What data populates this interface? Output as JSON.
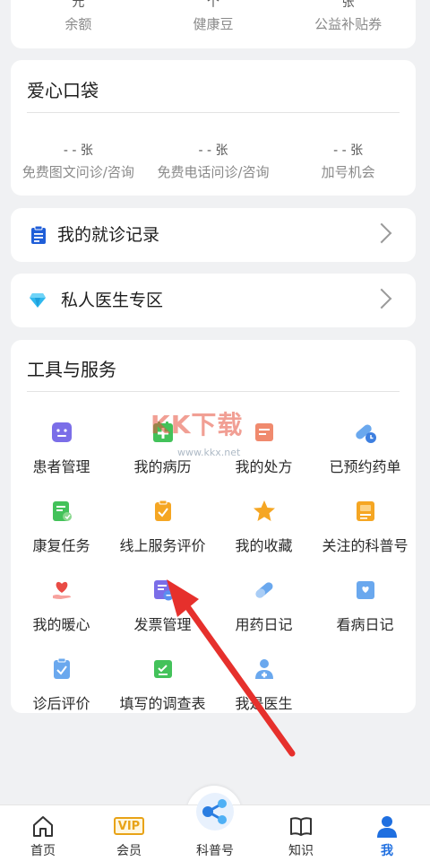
{
  "balance": {
    "items": [
      {
        "value": "元",
        "label": "余额"
      },
      {
        "value": "个",
        "label": "健康豆"
      },
      {
        "value": "张",
        "label": "公益补贴券"
      }
    ]
  },
  "love_pocket": {
    "title": "爱心口袋",
    "items": [
      {
        "value": "- -  张",
        "label": "免费图文问诊/咨询"
      },
      {
        "value": "- -  张",
        "label": "免费电话问诊/咨询"
      },
      {
        "value": "- -  张",
        "label": "加号机会"
      }
    ]
  },
  "visit_records": {
    "label": "我的就诊记录",
    "icon": "clipboard-icon"
  },
  "private_doctor": {
    "label": "私人医生专区",
    "icon": "diamond-icon"
  },
  "tools": {
    "title": "工具与服务",
    "items": [
      {
        "label": "患者管理",
        "icon": "patient-management-icon"
      },
      {
        "label": "我的病历",
        "icon": "medical-record-icon"
      },
      {
        "label": "我的处方",
        "icon": "prescription-icon"
      },
      {
        "label": "已预约药单",
        "icon": "pill-clock-icon"
      },
      {
        "label": "康复任务",
        "icon": "rehab-task-icon"
      },
      {
        "label": "线上服务评价",
        "icon": "service-review-icon"
      },
      {
        "label": "我的收藏",
        "icon": "star-icon"
      },
      {
        "label": "关注的科普号",
        "icon": "science-account-icon"
      },
      {
        "label": "我的暖心",
        "icon": "heart-hand-icon"
      },
      {
        "label": "发票管理",
        "icon": "invoice-icon"
      },
      {
        "label": "用药日记",
        "icon": "pill-icon"
      },
      {
        "label": "看病日记",
        "icon": "diary-icon"
      },
      {
        "label": "诊后评价",
        "icon": "review-clipboard-icon"
      },
      {
        "label": "填写的调查表",
        "icon": "survey-icon"
      },
      {
        "label": "我是医生",
        "icon": "doctor-icon"
      }
    ]
  },
  "watermark": {
    "text": "KK下载",
    "sub": "www.kkx.net"
  },
  "tabbar": {
    "items": [
      {
        "label": "首页",
        "icon": "home-icon"
      },
      {
        "label": "会员",
        "icon": "vip-icon",
        "badge": "VIP"
      },
      {
        "label": "科普号",
        "icon": "share-network-icon"
      },
      {
        "label": "知识",
        "icon": "book-icon"
      },
      {
        "label": "我",
        "icon": "user-icon",
        "active": true
      }
    ]
  },
  "colors": {
    "accent": "#1f6fe0",
    "purple": "#7b6ee8",
    "green": "#43c25a",
    "orange": "#f5a623",
    "blue": "#6aa8ee",
    "red": "#e94b45"
  }
}
